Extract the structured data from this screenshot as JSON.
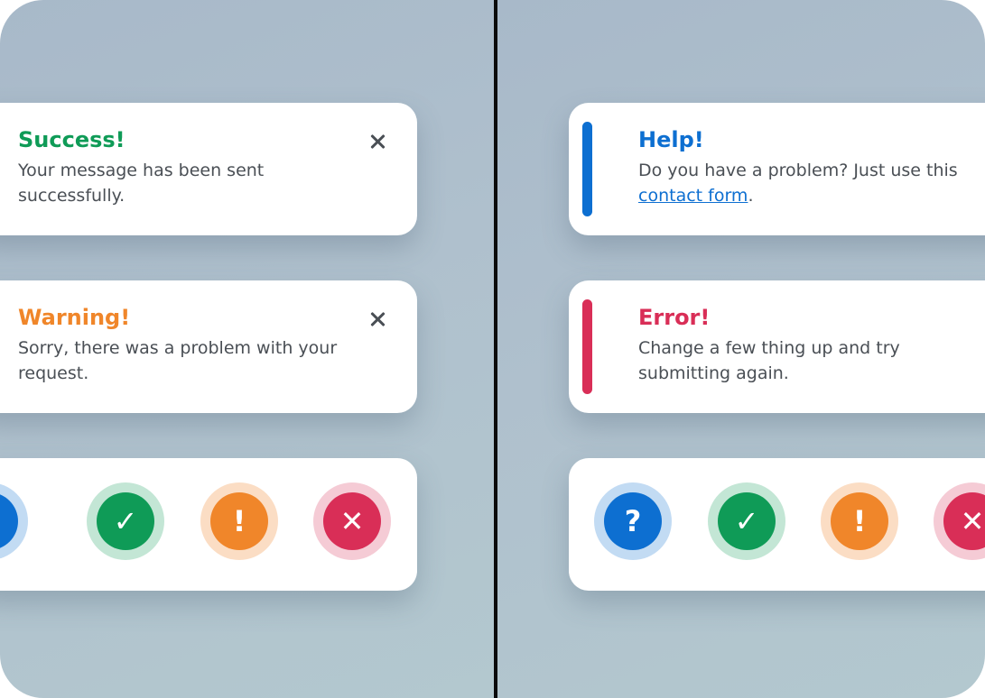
{
  "left": {
    "success": {
      "title": "Success!",
      "message": "Your message has been sent successfully.",
      "close_label": "close"
    },
    "warning": {
      "title": "Warning!",
      "message": "Sorry, there was a problem with your request.",
      "close_label": "close"
    }
  },
  "right": {
    "help": {
      "title": "Help!",
      "message_prefix": "Do you have a problem? Just use this",
      "link_text": "contact form",
      "message_suffix": "."
    },
    "error": {
      "title": "Error!",
      "message": "Change a few thing up and try submitting again."
    }
  },
  "icons": {
    "help_glyph": "?",
    "success_glyph": "✓",
    "warning_glyph": "!",
    "error_glyph": "✕"
  },
  "colors": {
    "success": "#0f9b57",
    "warning": "#f0862a",
    "help": "#0d6fd1",
    "error": "#d92e57",
    "text": "#4a4f55"
  }
}
